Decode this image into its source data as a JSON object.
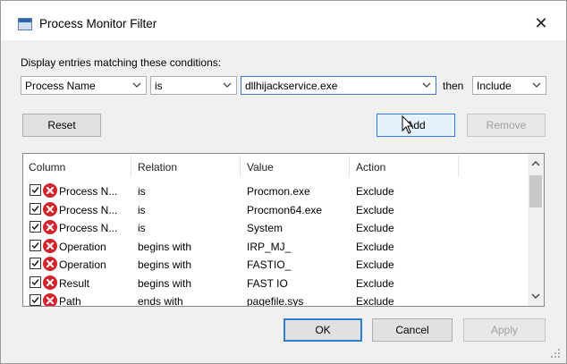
{
  "window": {
    "title": "Process Monitor Filter",
    "close_glyph": "✕"
  },
  "prompt": "Display entries matching these conditions:",
  "condition": {
    "column": "Process Name",
    "relation": "is",
    "value": "dllhijackservice.exe",
    "then_label": "then",
    "action": "Include"
  },
  "buttons": {
    "reset": "Reset",
    "add": "Add",
    "remove": "Remove",
    "ok": "OK",
    "cancel": "Cancel",
    "apply": "Apply"
  },
  "table": {
    "headers": [
      "Column",
      "Relation",
      "Value",
      "Action"
    ],
    "rows": [
      {
        "column": "Process N...",
        "relation": "is",
        "value": "Procmon.exe",
        "action": "Exclude"
      },
      {
        "column": "Process N...",
        "relation": "is",
        "value": "Procmon64.exe",
        "action": "Exclude"
      },
      {
        "column": "Process N...",
        "relation": "is",
        "value": "System",
        "action": "Exclude"
      },
      {
        "column": "Operation",
        "relation": "begins with",
        "value": "IRP_MJ_",
        "action": "Exclude"
      },
      {
        "column": "Operation",
        "relation": "begins with",
        "value": "FASTIO_",
        "action": "Exclude"
      },
      {
        "column": "Result",
        "relation": "begins with",
        "value": "FAST IO",
        "action": "Exclude"
      },
      {
        "column": "Path",
        "relation": "ends with",
        "value": "pagefile.sys",
        "action": "Exclude"
      }
    ]
  },
  "icons": {
    "app": "process-monitor-icon",
    "row_checked": "checkbox-checked-icon",
    "row_exclude": "exclude-x-icon",
    "dropdown": "chevron-down-icon"
  },
  "colors": {
    "exclude_icon": "#d0242a",
    "focus_border": "#2f7dd7"
  }
}
